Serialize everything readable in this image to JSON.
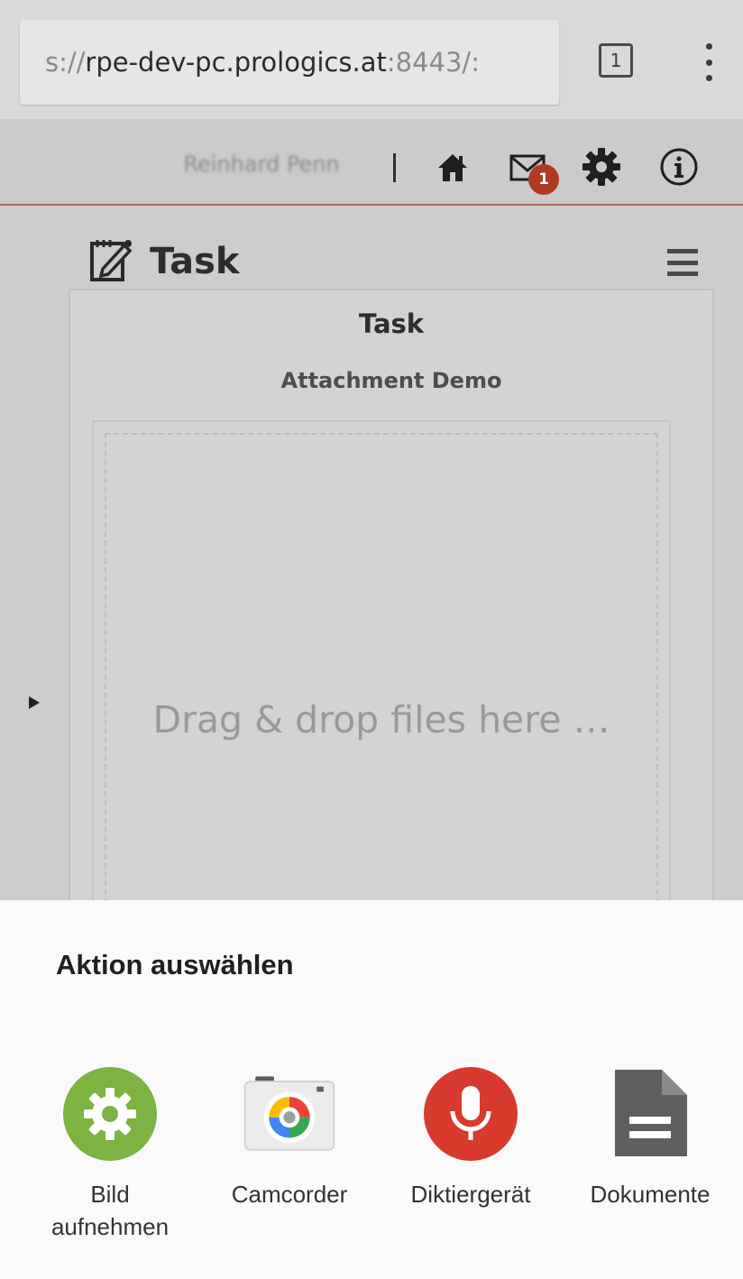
{
  "browser": {
    "url_prefix": "s://",
    "url_host": "rpe-dev-pc.prologics.at",
    "url_suffix": ":8443/:",
    "tab_count": "1"
  },
  "appbar": {
    "username": "Reinhard Penn",
    "notification_count": "1"
  },
  "task_header": {
    "title": "Task"
  },
  "panel": {
    "title": "Task",
    "subtitle": "Attachment Demo",
    "dropzone_text": "Drag & drop files here …"
  },
  "sheet": {
    "title": "Aktion auswählen",
    "actions": [
      {
        "label": "Bild\naufnehmen",
        "icon": "gear-icon",
        "color": "#7cb342"
      },
      {
        "label": "Camcorder",
        "icon": "camera-icon",
        "color": "#ececec"
      },
      {
        "label": "Diktiergerät",
        "icon": "microphone-icon",
        "color": "#d93a2e"
      },
      {
        "label": "Dokumente",
        "icon": "document-icon",
        "color": "#5f5f5f"
      }
    ]
  },
  "colors": {
    "appbar_underline": "#b06a5e",
    "badge": "#b03a22"
  }
}
